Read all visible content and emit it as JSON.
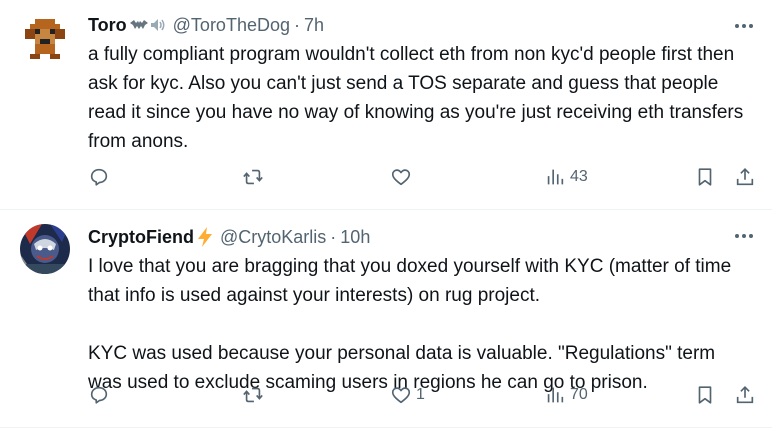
{
  "tweets": [
    {
      "name": "Toro",
      "handle": "@ToroTheDog",
      "dot": "·",
      "time": "7h",
      "text": "a fully compliant program wouldn't collect eth from non kyc'd people first then ask for kyc. Also you can't just send a TOS separate and guess that people read it since you have no way of knowing as you're just receiving eth transfers from anons.",
      "name_emoji": [
        "bat-emoji",
        "speaker-emoji"
      ],
      "avatar": "pixel-dog-avatar",
      "reply_count": "",
      "retweet_count": "",
      "like_count": "",
      "views_count": "43"
    },
    {
      "name": "CryptoFiend",
      "name_emoji": "⚡",
      "handle": "@CrytoKarlis",
      "dot": "·",
      "time": "10h",
      "text": "I love that you are bragging that you doxed yourself with KYC (matter of time that info is used against your interests) on rug project.\n\nKYC was used because your personal data is valuable. \"Regulations\" term was used to exclude scaming users in regions he can go to prison.",
      "avatar": "comic-character-avatar",
      "reply_count": "",
      "retweet_count": "",
      "like_count": "1",
      "views_count": "70"
    }
  ],
  "colors": {
    "text": "#0f1419",
    "secondary": "#536471",
    "divider": "#eff3f4",
    "lightning": "#ffac33"
  },
  "icons": [
    "reply-icon",
    "retweet-icon",
    "like-icon",
    "views-icon",
    "bookmark-icon",
    "share-icon",
    "more-icon"
  ]
}
